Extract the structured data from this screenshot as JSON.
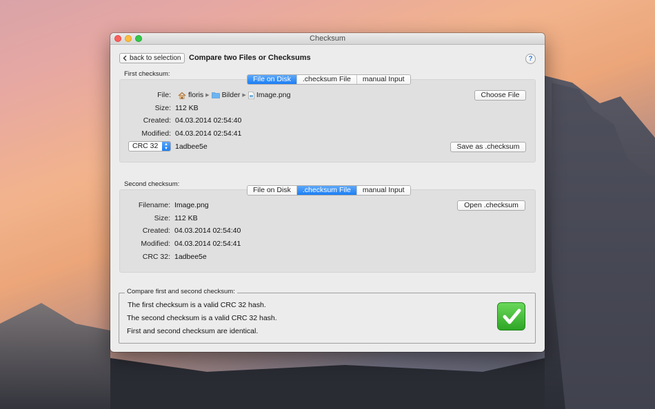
{
  "window": {
    "title": "Checksum"
  },
  "header": {
    "back_label": "back to selection",
    "title": "Compare two Files or Checksums",
    "help_label": "?"
  },
  "first": {
    "section_label": "First checksum:",
    "tabs": [
      "File on Disk",
      ".checksum File",
      "manual Input"
    ],
    "active_tab": "File on Disk",
    "file_label": "File:",
    "path": [
      "floris",
      "Bilder",
      "Image.png"
    ],
    "choose_button": "Choose File",
    "size_label": "Size:",
    "size": "112 KB",
    "created_label": "Created:",
    "created": "04.03.2014 02:54:40",
    "modified_label": "Modified:",
    "modified": "04.03.2014 02:54:41",
    "algorithm": "CRC 32",
    "checksum": "1adbee5e",
    "save_button": "Save as .checksum"
  },
  "second": {
    "section_label": "Second checksum:",
    "tabs": [
      "File on Disk",
      ".checksum File",
      "manual Input"
    ],
    "active_tab": ".checksum File",
    "filename_label": "Filename:",
    "filename": "Image.png",
    "open_button": "Open .checksum",
    "size_label": "Size:",
    "size": "112 KB",
    "created_label": "Created:",
    "created": "04.03.2014 02:54:40",
    "modified_label": "Modified:",
    "modified": "04.03.2014 02:54:41",
    "crc_label": "CRC 32:",
    "crc": "1adbee5e"
  },
  "compare": {
    "legend": "Compare first and second checksum:",
    "lines": [
      "The first checksum is a valid CRC 32 hash.",
      "The second checksum is a valid CRC 32 hash.",
      "First and second checksum are identical."
    ],
    "result_icon": "check-icon"
  },
  "colors": {
    "accent": "#1b7ef5",
    "success": "#2ea626"
  }
}
